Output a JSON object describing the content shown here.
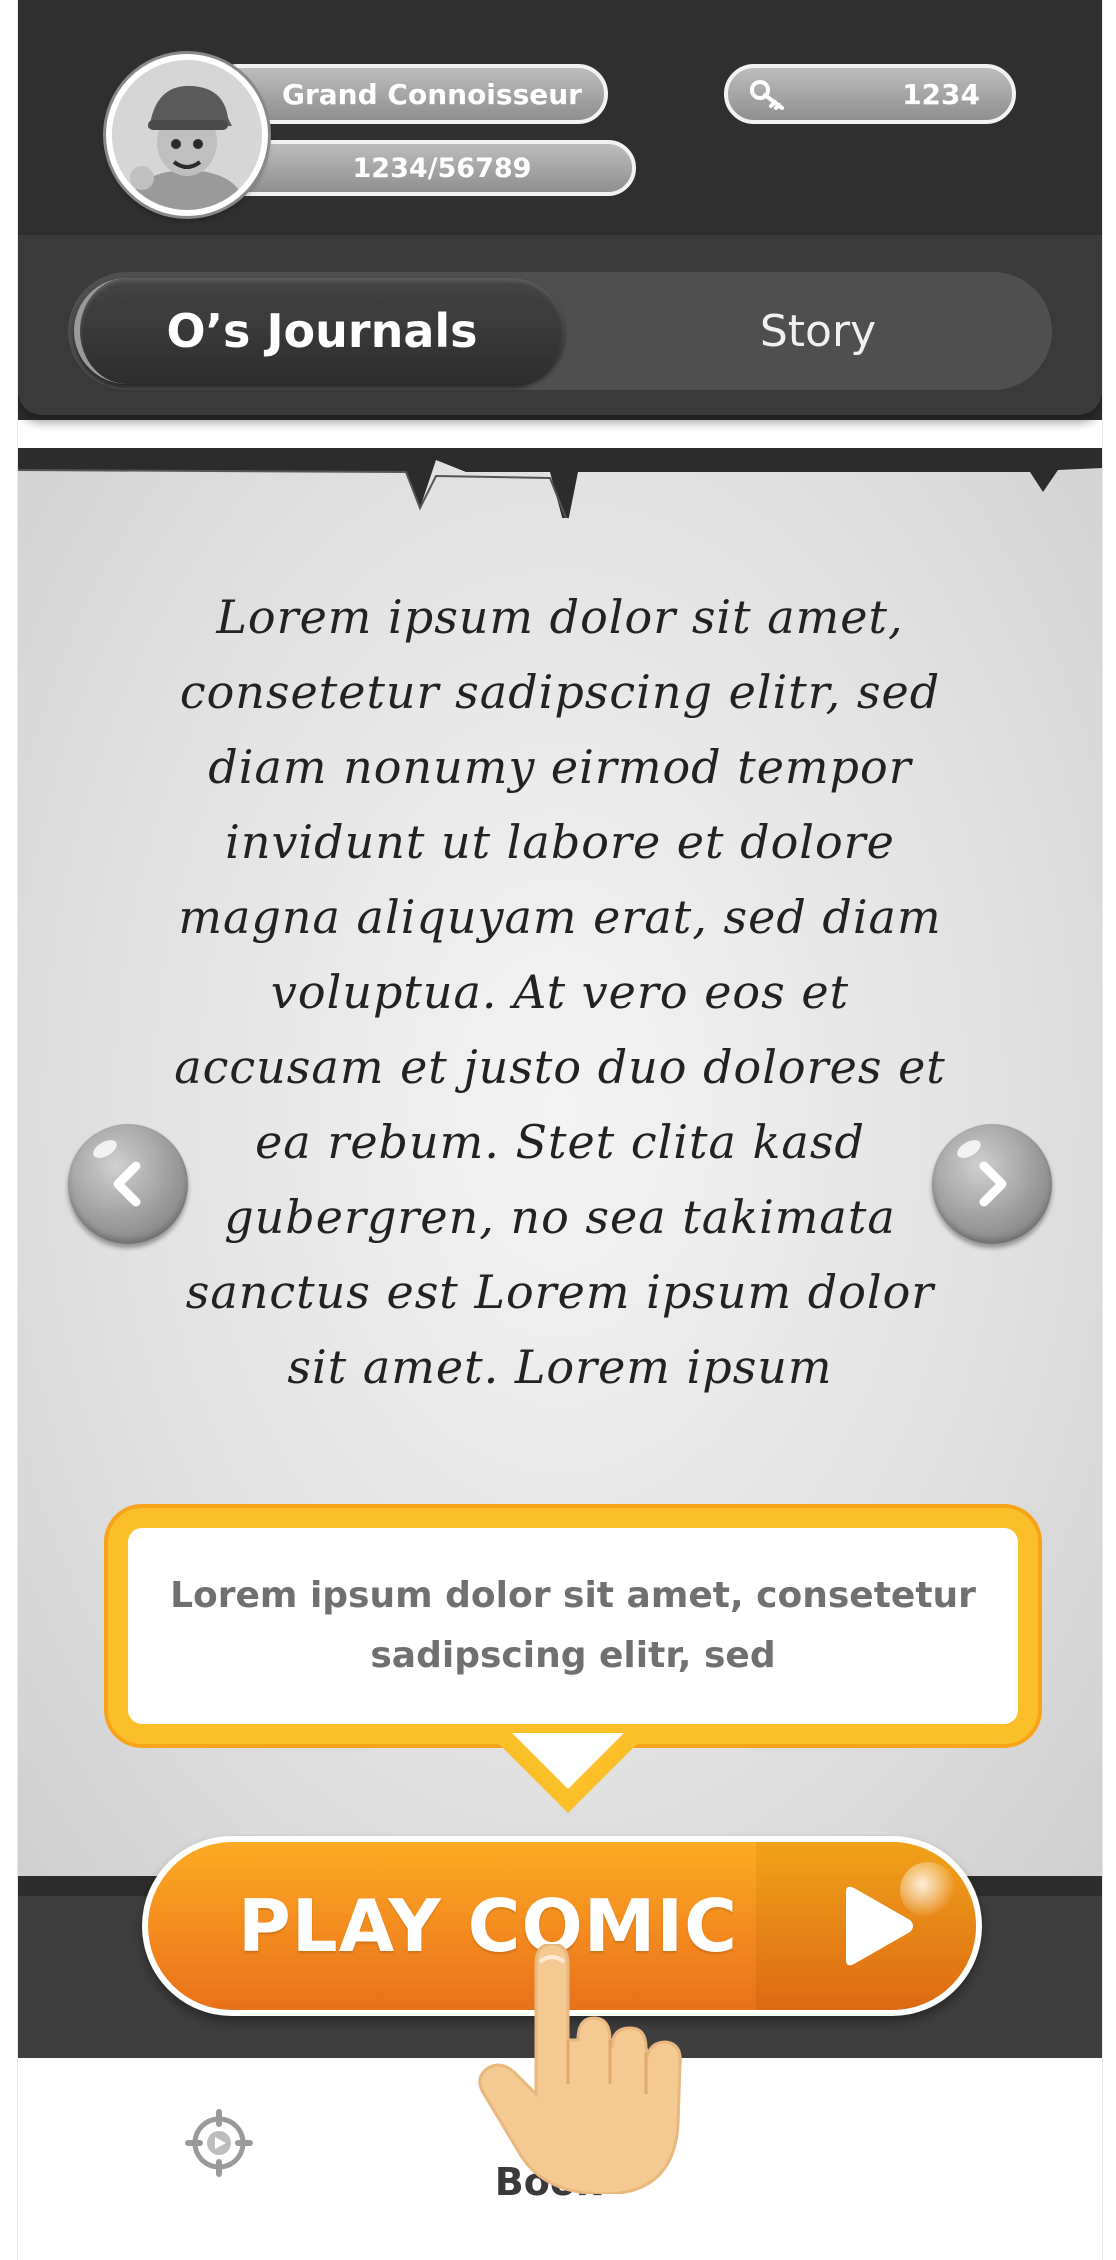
{
  "header": {
    "player_title": "Grand Connoisseur",
    "xp_progress": "1234/56789",
    "keys_count": "1234"
  },
  "tabs": [
    {
      "label": "O’s Journals",
      "active": true
    },
    {
      "label": "Story",
      "active": false
    }
  ],
  "story": {
    "text": "Lorem ipsum dolor sit amet, consetetur sadipscing elitr, sed diam nonumy eirmod tempor invidunt ut labore et dolore magna aliquyam erat, sed diam voluptua. At vero eos et accusam et justo duo dolores et ea rebum. Stet clita kasd gubergren, no sea takimata sanctus est Lorem ipsum dolor sit amet. Lorem ipsum"
  },
  "tooltip": {
    "text": "Lorem ipsum dolor sit amet, consetetur sadipscing elitr, sed"
  },
  "play_button": {
    "label": "PLAY COMIC"
  },
  "bottom_nav": {
    "book_label": "Book"
  },
  "icons": {
    "key": "key-icon",
    "prev": "chevron-left-icon",
    "next": "chevron-right-icon",
    "play": "play-icon",
    "target": "target-icon",
    "hand": "hand-pointer-icon"
  },
  "colors": {
    "header_dark": "#2f2f2f",
    "tab_bar": "#4f4f4f",
    "accent_orange": "#f48a1e",
    "tooltip_border": "#fbbf2a",
    "text_dark": "#222222"
  }
}
